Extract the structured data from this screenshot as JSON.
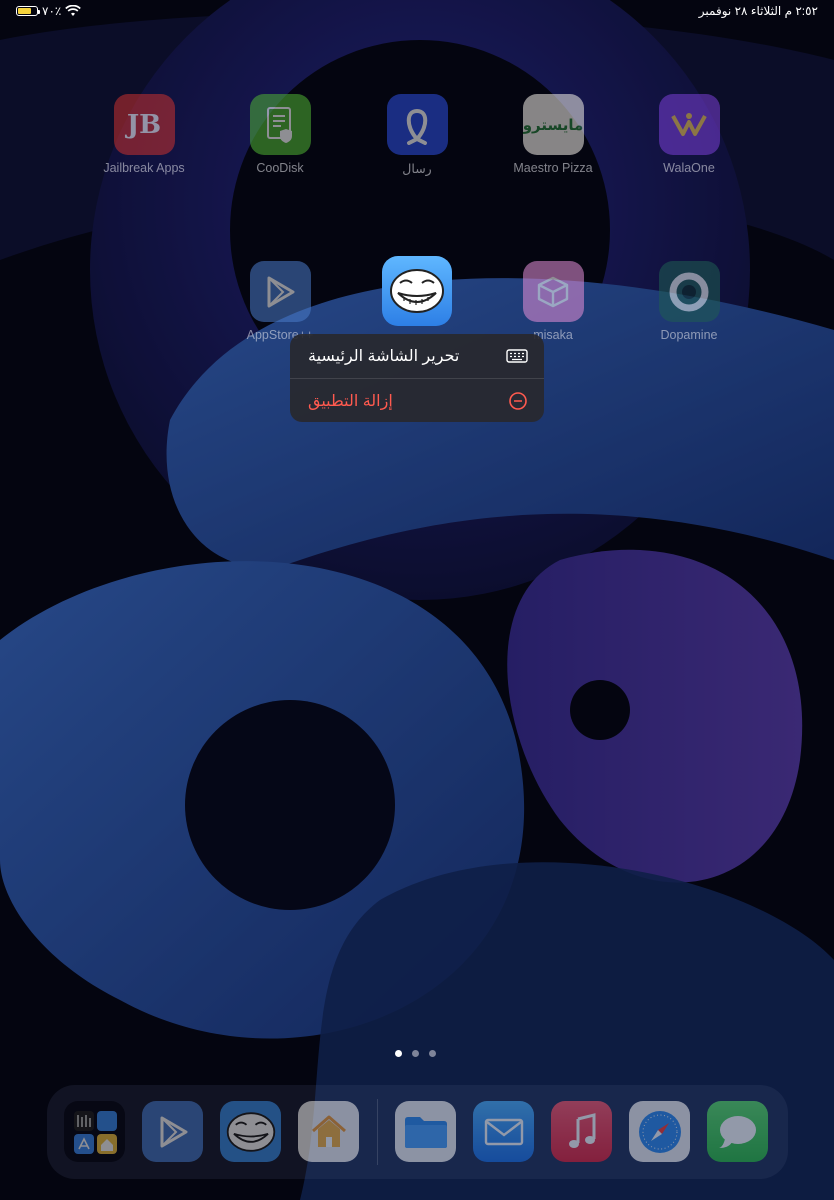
{
  "status_bar": {
    "time_date": "٢:٥٢ م  الثلاثاء ٢٨ نوفمبر",
    "battery_percent": "٧٠٪",
    "battery_level": 0.7
  },
  "home": {
    "row1": [
      {
        "label": "Jailbreak Apps",
        "icon": "jb-logo-icon"
      },
      {
        "label": "CooDisk",
        "icon": "document-shield-icon"
      },
      {
        "label": "رسال",
        "icon": "rasal-logo-icon"
      },
      {
        "label": "Maestro Pizza",
        "icon": "maestro-logo-icon",
        "icon_text": "مايسترو"
      },
      {
        "label": "WalaOne",
        "icon": "walaone-logo-icon"
      }
    ],
    "row2": [
      {
        "label": "AppStore++",
        "icon": "play-triangle-icon"
      },
      {
        "label": "",
        "icon": "troll-face-icon"
      },
      {
        "label": "misaka",
        "icon": "box-icon"
      },
      {
        "label": "Dopamine",
        "icon": "ring-icon"
      }
    ]
  },
  "context_menu": {
    "items": [
      {
        "label": "تحرير الشاشة الرئيسية",
        "icon": "keyboard-icon",
        "color": "#ffffff"
      },
      {
        "label": "إزالة التطبيق",
        "icon": "minus-circle-icon",
        "color": "#ff5a4f"
      }
    ]
  },
  "page_indicator": {
    "count": 3,
    "current": 1
  },
  "dock": {
    "apps": [
      {
        "name": "app-library-folder",
        "icon": "folder-grid-icon"
      },
      {
        "name": "appstore-plus",
        "icon": "play-triangle-icon"
      },
      {
        "name": "troll-app",
        "icon": "troll-face-icon"
      },
      {
        "name": "home-app",
        "icon": "house-icon"
      },
      {
        "name": "files-app",
        "icon": "folder-icon"
      },
      {
        "name": "mail-app",
        "icon": "envelope-icon"
      },
      {
        "name": "music-app",
        "icon": "music-note-icon"
      },
      {
        "name": "safari-app",
        "icon": "compass-icon"
      },
      {
        "name": "messages-app",
        "icon": "speech-bubble-icon"
      }
    ]
  },
  "colors": {
    "destructive": "#ff5a4f",
    "wallpaper_blue": "#2a55b8",
    "wallpaper_purple": "#3a2f9a"
  }
}
